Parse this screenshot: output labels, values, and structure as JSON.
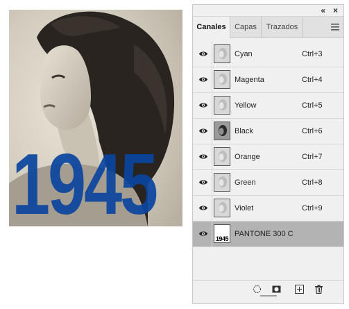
{
  "image": {
    "year_text": "1945",
    "overlay_color": "#0a45a0"
  },
  "panel": {
    "topbar": {
      "collapse_icon": "double-chevron-icon",
      "close_icon": "close-icon"
    },
    "tabs": [
      {
        "label": "Canales",
        "active": true
      },
      {
        "label": "Capas",
        "active": false
      },
      {
        "label": "Trazados",
        "active": false
      }
    ],
    "menu_icon": "panel-menu-icon",
    "channels": [
      {
        "name": "Cyan",
        "shortcut": "Ctrl+3"
      },
      {
        "name": "Magenta",
        "shortcut": "Ctrl+4"
      },
      {
        "name": "Yellow",
        "shortcut": "Ctrl+5"
      },
      {
        "name": "Black",
        "shortcut": "Ctrl+6"
      },
      {
        "name": "Orange",
        "shortcut": "Ctrl+7"
      },
      {
        "name": "Green",
        "shortcut": "Ctrl+8"
      },
      {
        "name": "Violet",
        "shortcut": "Ctrl+9"
      },
      {
        "name": "PANTONE 300 C",
        "shortcut": "",
        "selected": true,
        "thumb_text": "1945"
      }
    ],
    "bottom_icons": [
      "dotted-circle-selection-icon",
      "mask-icon",
      "new-channel-icon",
      "trash-icon"
    ],
    "selected_color": "#b3b3b3"
  }
}
